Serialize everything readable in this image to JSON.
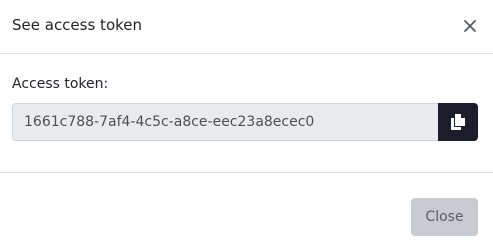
{
  "modal": {
    "title": "See access token",
    "close_icon": "close-icon"
  },
  "body": {
    "field_label": "Access token:",
    "token_value": "1661c788-7af4-4c5c-a8ce-eec23a8ecec0",
    "copy_icon": "copy-icon"
  },
  "footer": {
    "close_label": "Close"
  },
  "colors": {
    "copy_button_bg": "#1b1e2a",
    "input_bg": "#e9ecef",
    "close_button_bg": "#c8cbd0"
  }
}
